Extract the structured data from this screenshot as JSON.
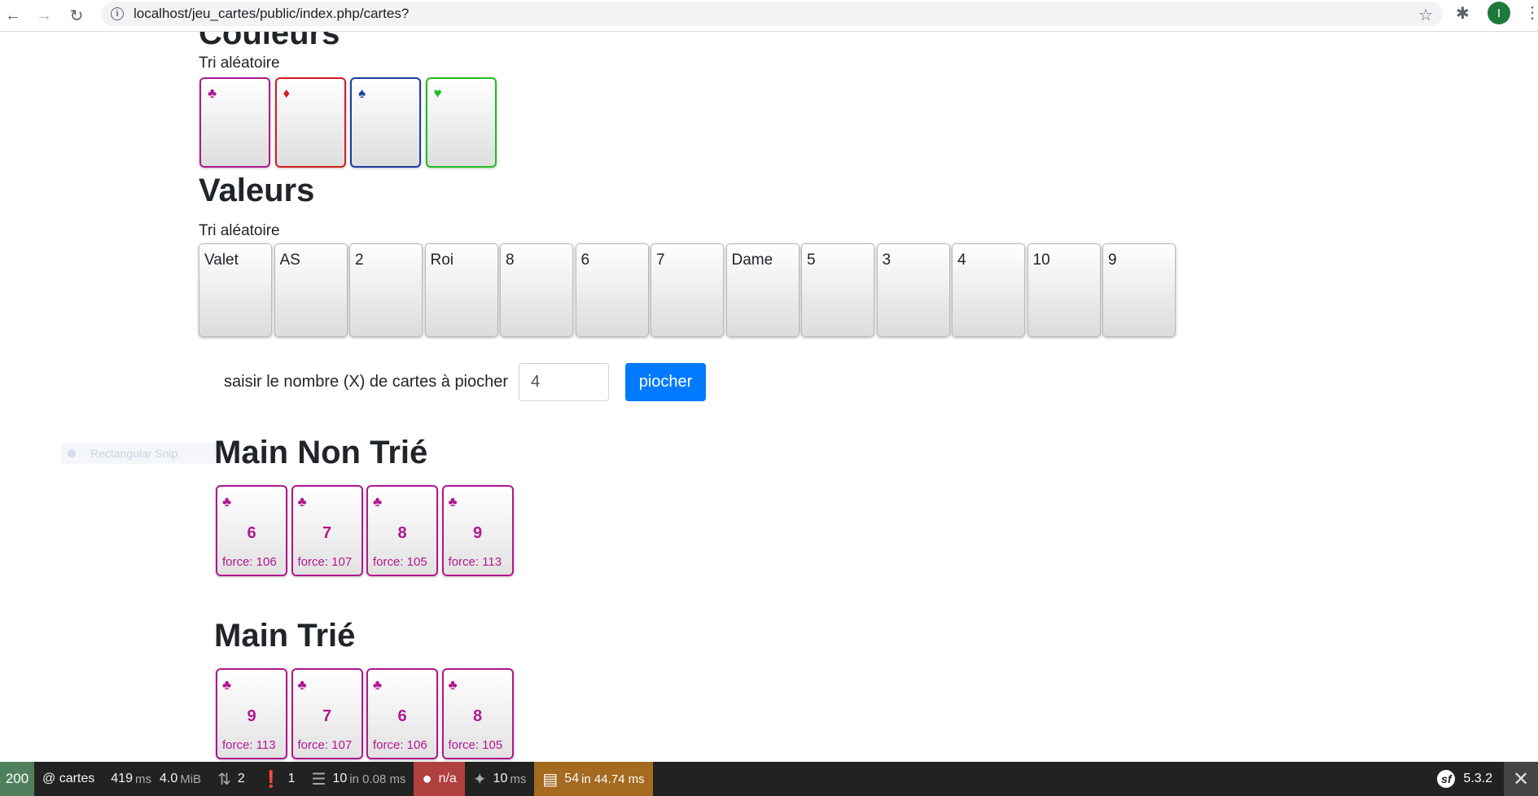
{
  "browser": {
    "url": "localhost/jeu_cartes/public/index.php/cartes?",
    "avatar_letter": "I"
  },
  "couleurs": {
    "title": "Couleurs",
    "subtitle": "Tri aléatoire",
    "cards": [
      {
        "suit": "♣",
        "color": "#b0188f"
      },
      {
        "suit": "♦",
        "color": "#d21f1f"
      },
      {
        "suit": "♠",
        "color": "#1a3fa0"
      },
      {
        "suit": "♥",
        "color": "#1fbf1f"
      }
    ]
  },
  "valeurs": {
    "title": "Valeurs",
    "subtitle": "Tri aléatoire",
    "cards": [
      "Valet",
      "AS",
      "2",
      "Roi",
      "8",
      "6",
      "7",
      "Dame",
      "5",
      "3",
      "4",
      "10",
      "9"
    ]
  },
  "draw_form": {
    "label": "saisir le nombre (X) de cartes à piocher",
    "value": "4",
    "button": "piocher"
  },
  "snip_overlay": "Rectangular Snip",
  "main_non_trie": {
    "title": "Main Non Trié",
    "cards": [
      {
        "suit": "♣",
        "value": "6",
        "force": "force: 106"
      },
      {
        "suit": "♣",
        "value": "7",
        "force": "force: 107"
      },
      {
        "suit": "♣",
        "value": "8",
        "force": "force: 105"
      },
      {
        "suit": "♣",
        "value": "9",
        "force": "force: 113"
      }
    ]
  },
  "main_trie": {
    "title": "Main Trié",
    "cards": [
      {
        "suit": "♣",
        "value": "9",
        "force": "force: 113"
      },
      {
        "suit": "♣",
        "value": "7",
        "force": "force: 107"
      },
      {
        "suit": "♣",
        "value": "6",
        "force": "force: 106"
      },
      {
        "suit": "♣",
        "value": "8",
        "force": "force: 105"
      }
    ]
  },
  "toolbar": {
    "status": "200",
    "route": "@ cartes",
    "time_value": "419",
    "time_unit": "ms",
    "memory_value": "4.0",
    "memory_unit": "MiB",
    "requests": "2",
    "logs": "1",
    "cache_value": "10",
    "cache_detail": "in 0.08 ms",
    "user": "n/a",
    "twig_value": "10",
    "twig_unit": "ms",
    "db_value": "54",
    "db_detail": "in 44.74 ms",
    "version": "5.3.2"
  }
}
